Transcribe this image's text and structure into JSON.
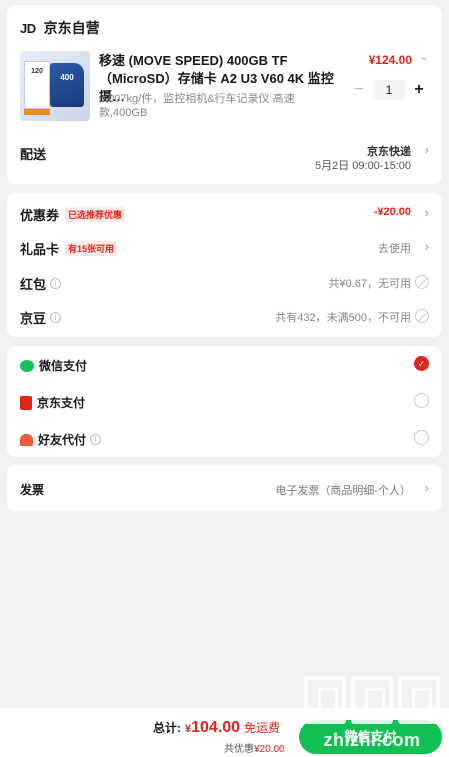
{
  "shop": {
    "logo": "JD",
    "name": "京东自营",
    "product": {
      "title": "移速 (MOVE SPEED) 400GB TF（MicroSD）存储卡 A2 U3 V60 4K 监控摄…",
      "subtitle": "0.007kg/件，监控相机&行车记录仪 高速款,400GB",
      "price": "¥124.00",
      "quantity": "1",
      "thumb_text": "400",
      "thumb_box_text": "120"
    },
    "delivery": {
      "label": "配送",
      "method": "京东快递",
      "time": "5月2日 09:00-15:00"
    }
  },
  "discounts": [
    {
      "label": "优惠券",
      "tag": "已选推荐优惠",
      "value": "-¥20.00"
    },
    {
      "label": "礼品卡",
      "tag": "有15张可用",
      "value": "去使用"
    },
    {
      "label": "红包",
      "value": "共¥0.67，无可用"
    },
    {
      "label": "京豆",
      "value": "共有432，未满500，不可用"
    }
  ],
  "payment": [
    {
      "label": "微信支付",
      "checked": true
    },
    {
      "label": "京东支付",
      "checked": false
    },
    {
      "label": "好友代付",
      "checked": false
    }
  ],
  "invoice": {
    "label": "发票",
    "value": "电子发票（商品明细-个人）"
  },
  "bottom": {
    "total_label": "总计:",
    "currency": "¥",
    "total": "104.00",
    "shipping": "免运费",
    "saved_label": "共优惠",
    "saved": "¥20.00",
    "pay_button": "微信支付"
  },
  "watermark": "zhizhi.com",
  "colors": {
    "accent": "#e1251b",
    "wechat": "#10c054"
  }
}
